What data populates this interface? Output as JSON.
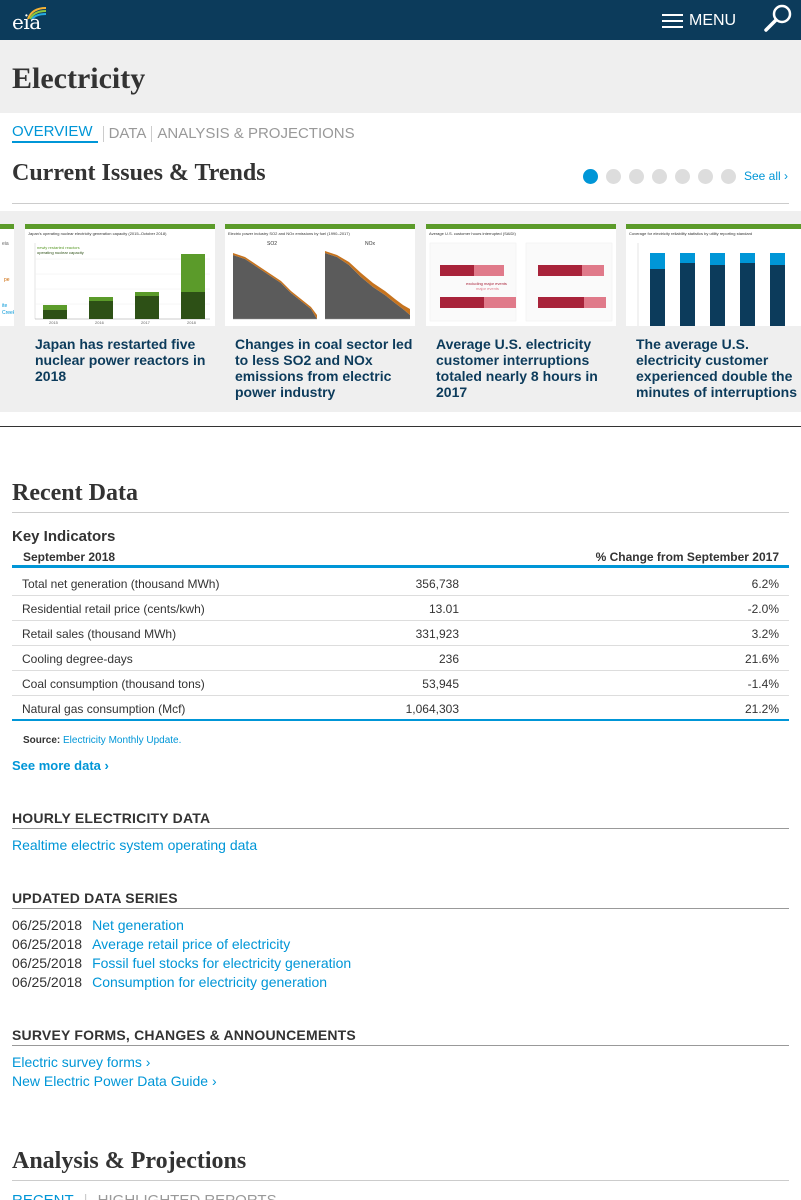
{
  "header": {
    "logo_text": "eia",
    "menu_label": "MENU"
  },
  "page": {
    "title": "Electricity"
  },
  "tabs": [
    {
      "label": "OVERVIEW",
      "active": true
    },
    {
      "label": "DATA",
      "active": false
    },
    {
      "label": "ANALYSIS & PROJECTIONS",
      "active": false
    }
  ],
  "trends": {
    "title": "Current Issues & Trends",
    "see_all": "See all ›",
    "dot_count": 7,
    "active_dot": 1,
    "cards": [
      {
        "title": "Japan has restarted five nuclear power reactors in 2018",
        "thumb_caption": "Japan's operating nuclear electricity generation capacity (2015–October 2018)"
      },
      {
        "title": "Changes in coal sector led to less SO2 and NOx emissions from electric power industry",
        "thumb_caption": "Electric power industry SO2 and NOx emissions by fuel (1990–2017)"
      },
      {
        "title": "Average U.S. electricity customer interruptions totaled nearly 8 hours in 2017",
        "thumb_caption": "Average U.S. customer hours interrupted (SAIDI)"
      },
      {
        "title": "The average U.S. electricity customer experienced double the minutes of interruptions",
        "thumb_caption": "Coverage for electricity reliability statistics by utility reporting standard"
      }
    ]
  },
  "recent": {
    "title": "Recent Data",
    "ki_title": "Key Indicators",
    "col_period": "September 2018",
    "col_change": "% Change from September 2017",
    "rows": [
      {
        "label": "Total net generation (thousand MWh)",
        "value": "356,738",
        "change": "6.2%"
      },
      {
        "label": "Residential retail price (cents/kwh)",
        "value": "13.01",
        "change": "-2.0%"
      },
      {
        "label": "Retail sales (thousand MWh)",
        "value": "331,923",
        "change": "3.2%"
      },
      {
        "label": "Cooling degree-days",
        "value": "236",
        "change": "21.6%"
      },
      {
        "label": "Coal consumption (thousand tons)",
        "value": "53,945",
        "change": "-1.4%"
      },
      {
        "label": "Natural gas consumption (Mcf)",
        "value": "1,064,303",
        "change": "21.2%"
      }
    ],
    "source_label": "Source:",
    "source_link": "Electricity Monthly Update.",
    "see_more": "See more data ›"
  },
  "hourly": {
    "title": "HOURLY ELECTRICITY DATA",
    "link": "Realtime electric system operating data"
  },
  "updated": {
    "title": "UPDATED DATA SERIES",
    "rows": [
      {
        "date": "06/25/2018",
        "link": "Net generation"
      },
      {
        "date": "06/25/2018",
        "link": "Average retail price of electricity"
      },
      {
        "date": "06/25/2018",
        "link": "Fossil fuel stocks for electricity generation"
      },
      {
        "date": "06/25/2018",
        "link": "Consumption for electricity generation"
      }
    ]
  },
  "survey": {
    "title": "SURVEY FORMS, CHANGES & ANNOUNCEMENTS",
    "links": [
      "Electric survey forms ›",
      "New Electric Power Data Guide ›"
    ]
  },
  "analysis": {
    "title": "Analysis & Projections",
    "tab1": "RECENT",
    "tab2": "HIGHLIGHTED REPORTS"
  },
  "colors": {
    "nav_bg": "#0c3b5b",
    "accent": "#0096d7",
    "green": "#5b9b2a"
  }
}
